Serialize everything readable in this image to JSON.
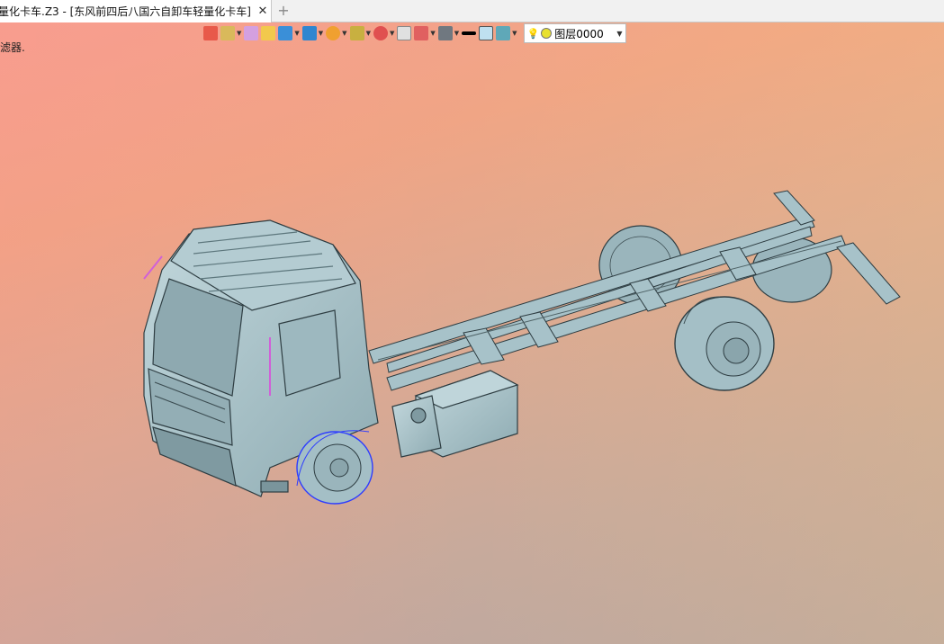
{
  "window": {
    "tab_title": "量化卡车.Z3 - [东风前四后八国六自卸车轻量化卡车]",
    "tab_close": "✕",
    "new_tab": "+"
  },
  "toolbar": {
    "layer_label": "图层0000"
  },
  "status": {
    "message": "滤器."
  },
  "colors": {
    "model": "#a7c2c9",
    "model_dark": "#6f8a91",
    "highlight": "#d060d8",
    "selection": "#2d3cff"
  }
}
